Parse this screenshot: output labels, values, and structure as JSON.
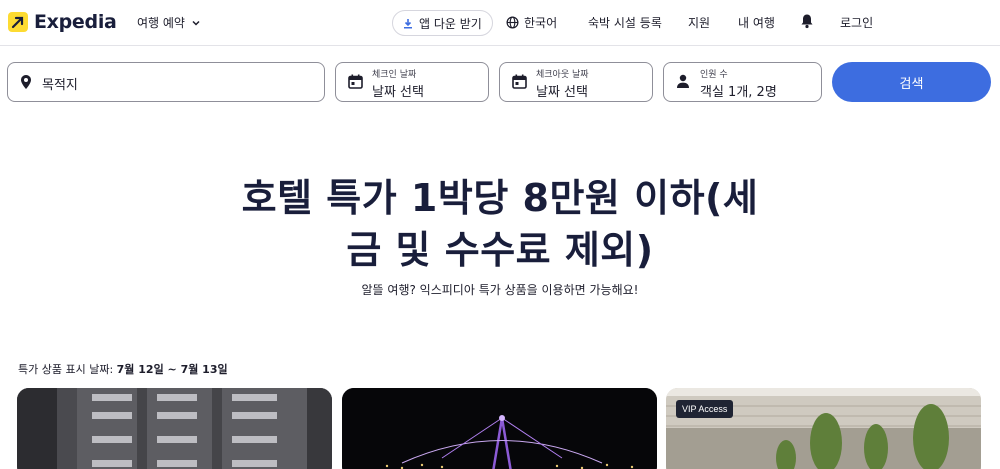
{
  "header": {
    "logo_text": "Expedia",
    "trip_menu": "여행 예약",
    "app_download": "앱 다운 받기",
    "language": "한국어",
    "list_property": "숙박 시설 등록",
    "support": "지원",
    "my_trips": "내 여행",
    "login": "로그인"
  },
  "search": {
    "destination_placeholder": "목적지",
    "checkin_label": "체크인 날짜",
    "checkin_value": "날짜 선택",
    "checkout_label": "체크아웃 날짜",
    "checkout_value": "날짜 선택",
    "guests_label": "인원 수",
    "guests_value": "객실 1개, 2명",
    "search_button": "검색"
  },
  "hero": {
    "title_line1": "호텔 특가 1박당 8만원 이하(세",
    "title_line2": "금 및 수수료 제외)",
    "subtitle": "알뜰 여행? 익스피디아 특가 상품을 이용하면 가능해요!"
  },
  "deals": {
    "dates_prefix": "특가 상품 표시 날짜: ",
    "dates_value": "7월 12일 ~ 7월 13일",
    "cards": [
      {
        "badge": ""
      },
      {
        "badge": ""
      },
      {
        "badge": "VIP Access"
      }
    ]
  },
  "colors": {
    "accent": "#3d6de0",
    "brand_yellow": "#fddb32",
    "brand_navy": "#191e3b"
  }
}
